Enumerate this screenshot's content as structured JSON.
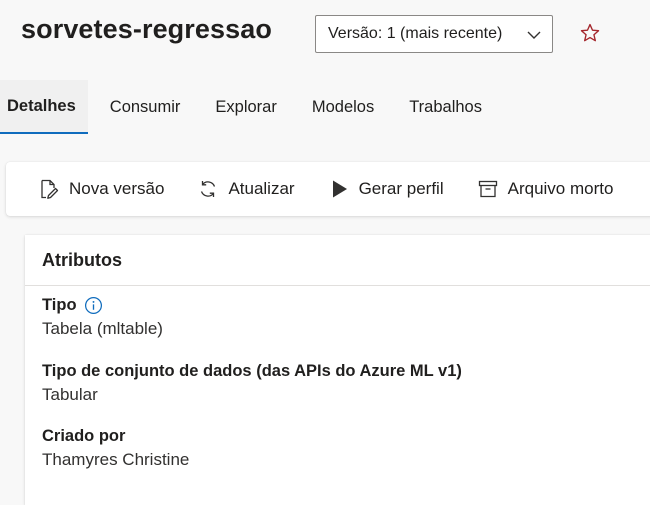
{
  "header": {
    "title": "sorvetes-regressao",
    "version_select": "Versão: 1 (mais recente)"
  },
  "tabs": [
    {
      "label": "Detalhes",
      "active": true
    },
    {
      "label": "Consumir"
    },
    {
      "label": "Explorar"
    },
    {
      "label": "Modelos"
    },
    {
      "label": "Trabalhos"
    }
  ],
  "toolbar": {
    "new_version": "Nova versão",
    "refresh": "Atualizar",
    "generate_profile": "Gerar perfil",
    "archive": "Arquivo morto"
  },
  "attributes": {
    "title": "Atributos",
    "items": [
      {
        "label": "Tipo",
        "value": "Tabela (mltable)"
      },
      {
        "label": "Tipo de conjunto de dados (das APIs do Azure ML v1)",
        "value": "Tabular"
      },
      {
        "label": "Criado por",
        "value": "Thamyres Christine"
      }
    ]
  },
  "colors": {
    "accent": "#0f6cbd",
    "star": "#a4262c",
    "background": "#f8f8f8"
  },
  "icons": {
    "star": "star-outline-icon",
    "chevron": "chevron-down-icon",
    "info": "info-icon"
  }
}
